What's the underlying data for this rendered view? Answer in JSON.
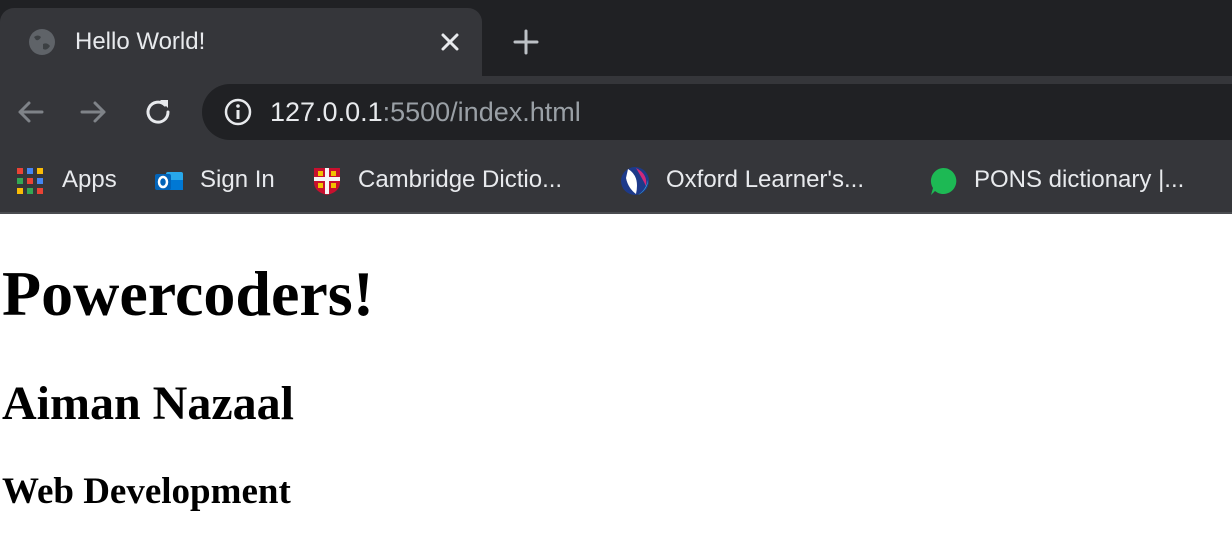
{
  "browser": {
    "tab": {
      "title": "Hello World!"
    },
    "address": {
      "host": "127.0.0.1",
      "path": ":5500/index.html"
    },
    "bookmarks": [
      {
        "label": "Apps",
        "icon": "apps-grid-icon"
      },
      {
        "label": "Sign In",
        "icon": "outlook-icon"
      },
      {
        "label": "Cambridge Dictio...",
        "icon": "cambridge-crest-icon"
      },
      {
        "label": "Oxford Learner's...",
        "icon": "oxford-learners-icon"
      },
      {
        "label": "PONS dictionary |...",
        "icon": "pons-icon"
      }
    ]
  },
  "page": {
    "h1": "Powercoders!",
    "h2": "Aiman Nazaal",
    "h3": "Web Development"
  },
  "colors": {
    "chrome_dark": "#202124",
    "chrome_toolbar": "#35363a",
    "text_light": "#e8eaed",
    "text_muted": "#9aa0a6"
  }
}
